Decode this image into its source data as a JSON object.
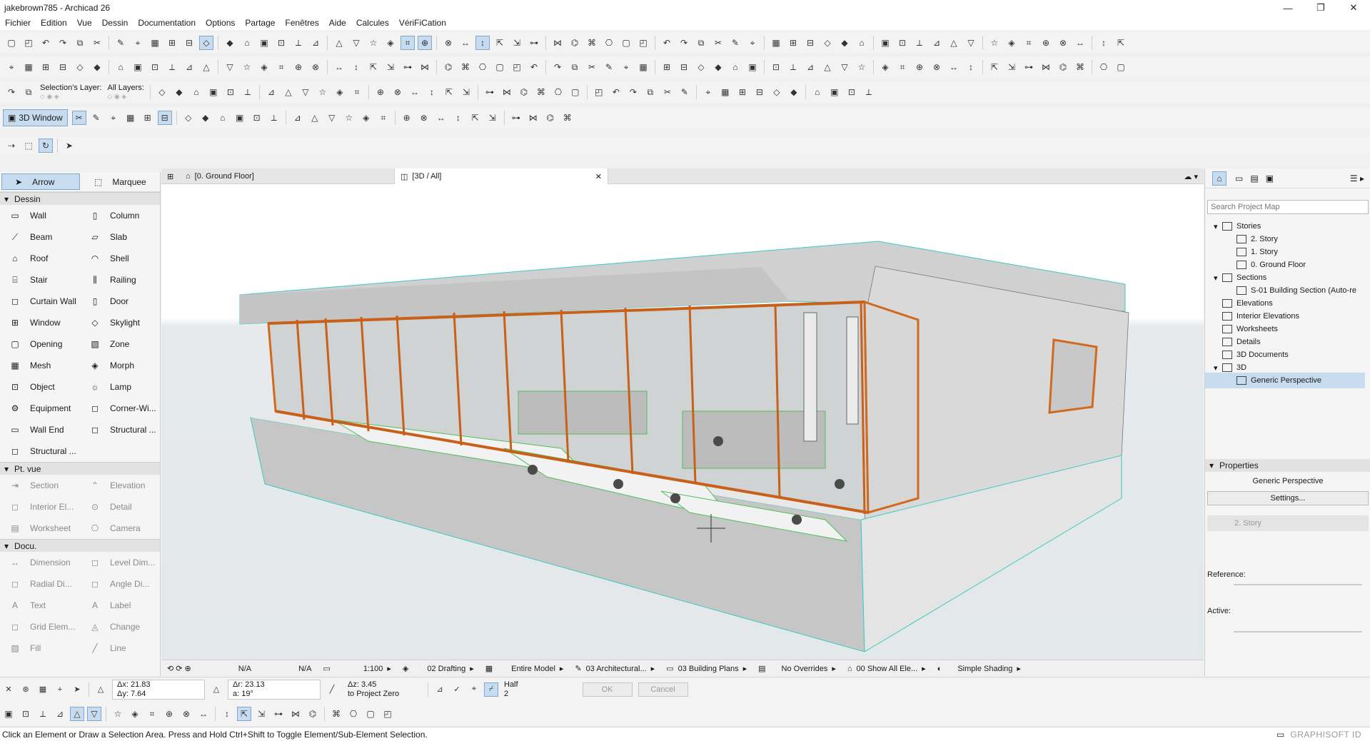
{
  "window": {
    "title": "jakebrown785 - Archicad 26",
    "min": "—",
    "max": "❐",
    "close": "✕"
  },
  "menubar": [
    "Fichier",
    "Edition",
    "Vue",
    "Dessin",
    "Documentation",
    "Options",
    "Partage",
    "Fenêtres",
    "Aide",
    "Calcules",
    "VériFiCation"
  ],
  "infobox": {
    "selection_layer": "Selection's Layer:",
    "all_layers": "All Layers:",
    "btn_3d_window": "3D Window"
  },
  "toolbox": {
    "arrow": "Arrow",
    "marquee": "Marquee",
    "groups": {
      "dessin": "Dessin",
      "ptvue": "Pt. vue",
      "docu": "Docu."
    },
    "dessin_tools": [
      [
        "Wall",
        "Column"
      ],
      [
        "Beam",
        "Slab"
      ],
      [
        "Roof",
        "Shell"
      ],
      [
        "Stair",
        "Railing"
      ],
      [
        "Curtain Wall",
        "Door"
      ],
      [
        "Window",
        "Skylight"
      ],
      [
        "Opening",
        "Zone"
      ],
      [
        "Mesh",
        "Morph"
      ],
      [
        "Object",
        "Lamp"
      ],
      [
        "Equipment",
        "Corner-Wi..."
      ],
      [
        "Wall End",
        "Structural ..."
      ],
      [
        "Structural ...",
        ""
      ]
    ],
    "ptvue_tools": [
      [
        "Section",
        "Elevation"
      ],
      [
        "Interior El...",
        "Detail"
      ],
      [
        "Worksheet",
        "Camera"
      ]
    ],
    "docu_tools": [
      [
        "Dimension",
        "Level Dim..."
      ],
      [
        "Radial Di...",
        "Angle Di..."
      ],
      [
        "Text",
        "Label"
      ],
      [
        "Grid Elem...",
        "Change"
      ],
      [
        "Fill",
        "Line"
      ]
    ]
  },
  "tabs": {
    "ground_floor": "[0. Ground Floor]",
    "view3d": "[3D / All]",
    "close": "✕"
  },
  "navigator": {
    "search_placeholder": "Search Project Map",
    "tree": [
      {
        "label": "Stories",
        "level": 1,
        "exp": "▾"
      },
      {
        "label": "2. Story",
        "level": 2
      },
      {
        "label": "1. Story",
        "level": 2
      },
      {
        "label": "0. Ground Floor",
        "level": 2
      },
      {
        "label": "Sections",
        "level": 1,
        "exp": "▾"
      },
      {
        "label": "S-01 Building Section (Auto-re",
        "level": 2
      },
      {
        "label": "Elevations",
        "level": 1
      },
      {
        "label": "Interior Elevations",
        "level": 1
      },
      {
        "label": "Worksheets",
        "level": 1
      },
      {
        "label": "Details",
        "level": 1
      },
      {
        "label": "3D Documents",
        "level": 1
      },
      {
        "label": "3D",
        "level": 1,
        "exp": "▾"
      },
      {
        "label": "Generic Perspective",
        "level": 2,
        "selected": true
      }
    ],
    "properties_header": "Properties",
    "properties_name": "Generic Perspective",
    "settings": "Settings...",
    "story": "2. Story",
    "reference": "Reference:",
    "active": "Active:"
  },
  "viewbar": {
    "na1": "N/A",
    "na2": "N/A",
    "scale": "1:100",
    "layer_combo": "02 Drafting",
    "model_view": "Entire Model",
    "pen_set": "03 Architectural...",
    "mvo": "03 Building Plans",
    "overrides": "No Overrides",
    "renovation": "00 Show All Ele...",
    "shading": "Simple Shading"
  },
  "coords": {
    "dx": "Δx: 21.83",
    "dy": "Δy: 7.64",
    "dr": "Δr: 23.13",
    "a": "a: 19°",
    "dz": "Δz: 3.45",
    "to_zero": "to Project Zero",
    "half": "Half",
    "half_n": "2",
    "ok": "OK",
    "cancel": "Cancel"
  },
  "status": {
    "hint": "Click an Element or Draw a Selection Area. Press and Hold Ctrl+Shift to Toggle Element/Sub-Element Selection.",
    "brand": "GRAPHISOFT ID"
  },
  "colors": {
    "accent": "#c8dcf0",
    "frame_orange": "#d06a1e",
    "selection_cyan": "#3fc9c0",
    "ground": "#e3e8ea"
  }
}
